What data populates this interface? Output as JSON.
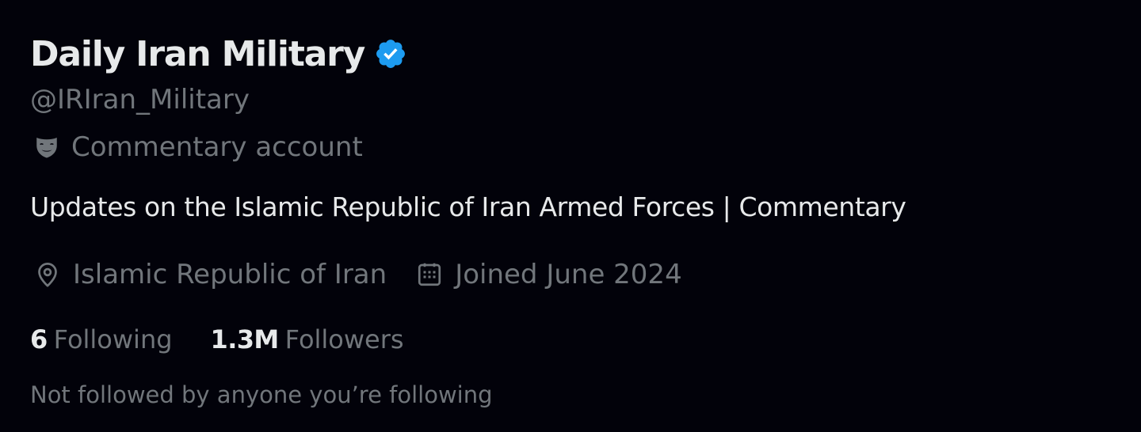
{
  "profile": {
    "display_name": "Daily Iran Military",
    "verified_icon": "verified-badge-icon",
    "handle": "@IRIran_Military",
    "label_icon": "theater-mask-icon",
    "label_text": "Commentary account",
    "bio": "Updates on the Islamic Republic of Iran Armed Forces | Commentary",
    "location_icon": "location-pin-icon",
    "location": "Islamic Republic of Iran",
    "joined_icon": "calendar-icon",
    "joined": "Joined June 2024",
    "following_count": "6",
    "following_label": "Following",
    "followers_count": "1.3M",
    "followers_label": "Followers",
    "mutuals_text": "Not followed by anyone you’re following"
  },
  "colors": {
    "background": "#02020a",
    "primary_text": "#e7e9ea",
    "secondary_text": "#71767b",
    "verified_blue": "#1d9bf0"
  }
}
